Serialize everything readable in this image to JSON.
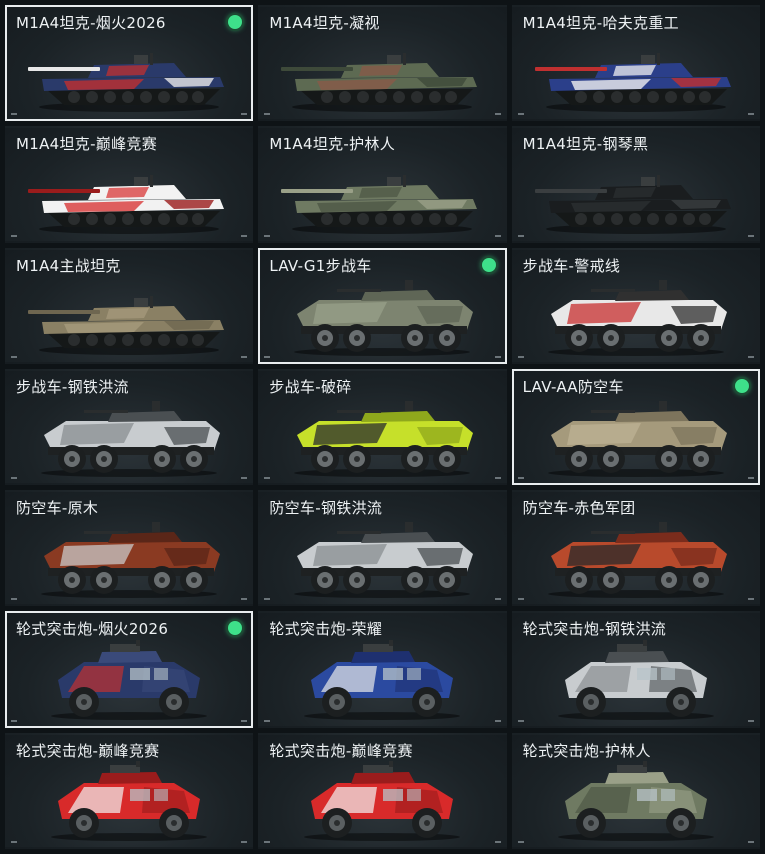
{
  "cards": [
    {
      "label": "M1A4坦克-烟火2026",
      "type": "tank",
      "selected": true,
      "equipped": true,
      "colors": [
        "#2a3a6a",
        "#c03030",
        "#e8e8e8"
      ]
    },
    {
      "label": "M1A4坦克-凝视",
      "type": "tank",
      "selected": false,
      "equipped": false,
      "colors": [
        "#5d6a52",
        "#8a5a48",
        "#3e4a3a"
      ]
    },
    {
      "label": "M1A4坦克-哈夫克重工",
      "type": "tank",
      "selected": false,
      "equipped": false,
      "colors": [
        "#2b3f8a",
        "#f0f0f0",
        "#c03030"
      ]
    },
    {
      "label": "M1A4坦克-巅峰竞赛",
      "type": "tank",
      "selected": false,
      "equipped": false,
      "colors": [
        "#f2f2f2",
        "#d83838",
        "#9a1c1c"
      ]
    },
    {
      "label": "M1A4坦克-护林人",
      "type": "tank",
      "selected": false,
      "equipped": false,
      "colors": [
        "#6f7a62",
        "#4e5846",
        "#9aa088"
      ]
    },
    {
      "label": "M1A4坦克-钢琴黑",
      "type": "tank",
      "selected": false,
      "equipped": false,
      "colors": [
        "#1a1d1f",
        "#2b2f31",
        "#3a3e40"
      ]
    },
    {
      "label": "M1A4主战坦克",
      "type": "tank",
      "selected": false,
      "equipped": false,
      "colors": [
        "#8a8064",
        "#a59a7c",
        "#6e6650"
      ]
    },
    {
      "label": "LAV-G1步战车",
      "type": "apc",
      "selected": true,
      "equipped": true,
      "colors": [
        "#7d8470",
        "#98a08a",
        "#5f6656"
      ]
    },
    {
      "label": "步战车-警戒线",
      "type": "apc",
      "selected": false,
      "equipped": false,
      "colors": [
        "#e8e8e8",
        "#c83030",
        "#303030"
      ]
    },
    {
      "label": "步战车-钢铁洪流",
      "type": "apc",
      "selected": false,
      "equipped": false,
      "colors": [
        "#c8cccf",
        "#8a8f92",
        "#4a4f52"
      ]
    },
    {
      "label": "步战车-破碎",
      "type": "apc",
      "selected": false,
      "equipped": false,
      "colors": [
        "#c6e02a",
        "#2a2e2e",
        "#8fa81c"
      ]
    },
    {
      "label": "LAV-AA防空车",
      "type": "apc",
      "selected": true,
      "equipped": true,
      "colors": [
        "#a59a7c",
        "#bdb294",
        "#7d745c"
      ]
    },
    {
      "label": "防空车-原木",
      "type": "apc",
      "selected": false,
      "equipped": false,
      "colors": [
        "#8a3a22",
        "#c8c8c8",
        "#5a2618"
      ]
    },
    {
      "label": "防空车-钢铁洪流",
      "type": "apc",
      "selected": false,
      "equipped": false,
      "colors": [
        "#c8cccf",
        "#8a8f92",
        "#4a4f52"
      ]
    },
    {
      "label": "防空车-赤色军团",
      "type": "apc",
      "selected": false,
      "equipped": false,
      "colors": [
        "#b84a2c",
        "#2a2a2a",
        "#7a2c1c"
      ]
    },
    {
      "label": "轮式突击炮-烟火2026",
      "type": "car",
      "selected": true,
      "equipped": true,
      "colors": [
        "#2a3a6a",
        "#c03030",
        "#3a4a7a"
      ]
    },
    {
      "label": "轮式突击炮-荣耀",
      "type": "car",
      "selected": false,
      "equipped": false,
      "colors": [
        "#2b4aa0",
        "#e8e8e8",
        "#1e3070"
      ]
    },
    {
      "label": "轮式突击炮-钢铁洪流",
      "type": "car",
      "selected": false,
      "equipped": false,
      "colors": [
        "#c8cccf",
        "#8a8f92",
        "#4a4f52"
      ]
    },
    {
      "label": "轮式突击炮-巅峰竞赛",
      "type": "car",
      "selected": false,
      "equipped": false,
      "colors": [
        "#d82a2a",
        "#f2f2f2",
        "#9a1c1c"
      ]
    },
    {
      "label": "轮式突击炮-巅峰竞赛",
      "type": "car",
      "selected": false,
      "equipped": false,
      "colors": [
        "#d82a2a",
        "#f2f2f2",
        "#9a1c1c"
      ]
    },
    {
      "label": "轮式突击炮-护林人",
      "type": "car",
      "selected": false,
      "equipped": false,
      "colors": [
        "#6f7a62",
        "#4e5846",
        "#9aa088"
      ]
    }
  ]
}
